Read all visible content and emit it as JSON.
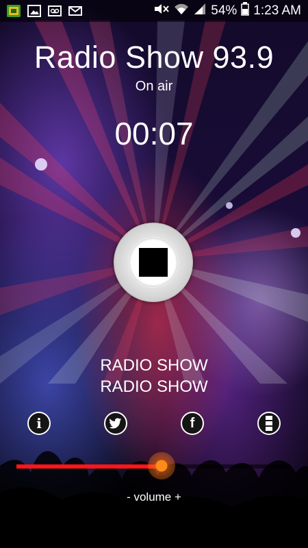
{
  "statusbar": {
    "battery": "54%",
    "time": "1:23 AM",
    "icons": [
      "app-icon",
      "image-icon",
      "voicemail-icon",
      "mail-icon",
      "mute-icon",
      "wifi-icon",
      "signal-icon",
      "battery-icon"
    ]
  },
  "player": {
    "station_title": "Radio Show 93.9",
    "status": "On air",
    "elapsed": "00:07",
    "button_state": "stop"
  },
  "now_playing": {
    "line1": "RADIO SHOW",
    "line2": "RADIO SHOW"
  },
  "social": [
    "info-icon",
    "twitter-icon",
    "facebook-icon",
    "menu-icon"
  ],
  "volume": {
    "label": "- volume +",
    "level": 0.53
  },
  "colors": {
    "slider_fill": "#ff1616",
    "thumb": "#ff8a1a"
  }
}
